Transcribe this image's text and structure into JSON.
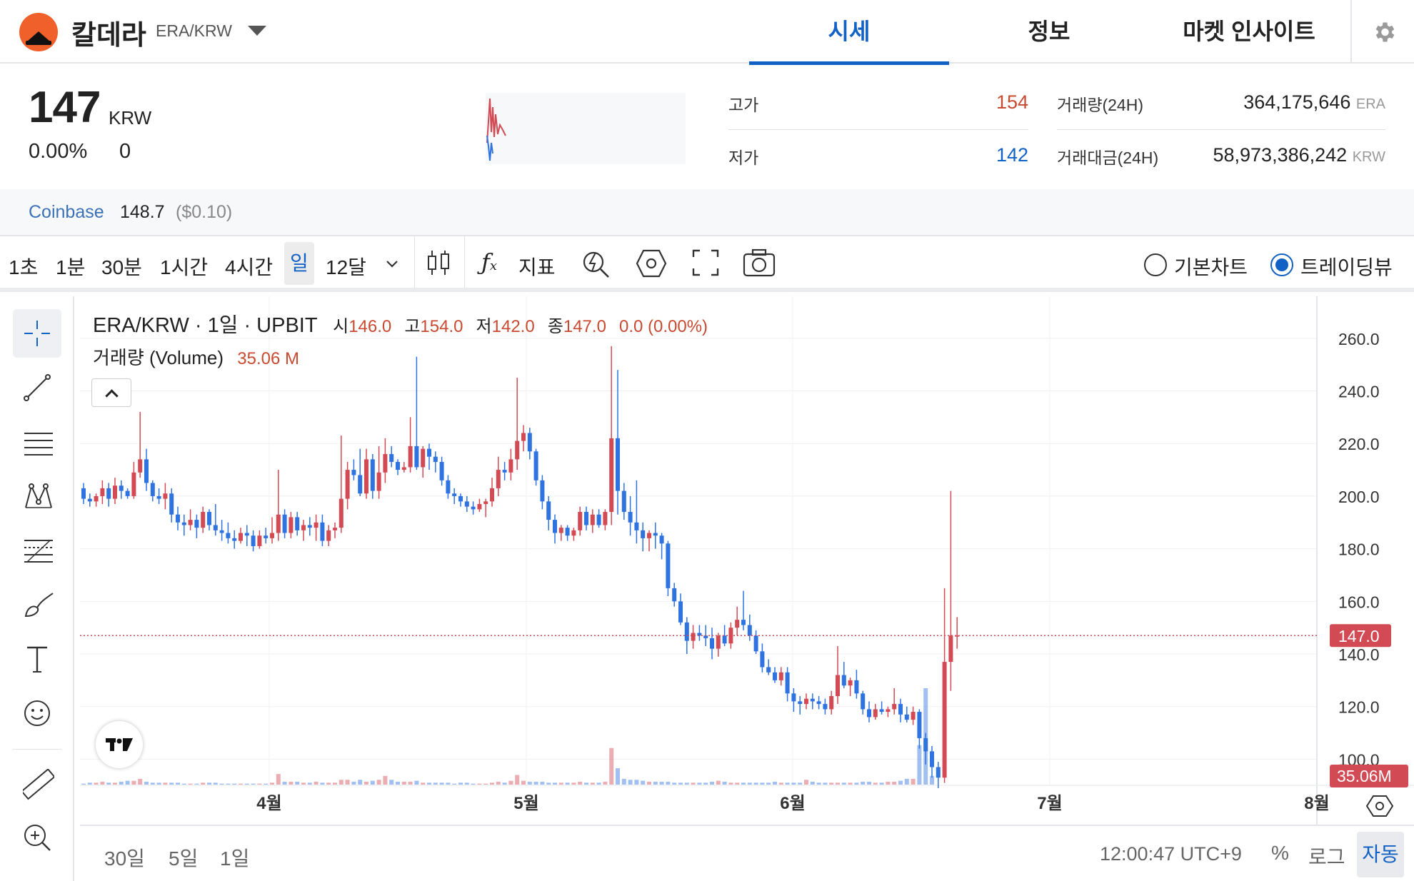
{
  "header": {
    "coin_name": "칼데라",
    "pair": "ERA/KRW",
    "tabs": [
      {
        "label": "시세",
        "active": true
      },
      {
        "label": "정보",
        "active": false
      },
      {
        "label": "마켓 인사이트",
        "active": false
      }
    ]
  },
  "summary": {
    "price": "147",
    "unit": "KRW",
    "change_pct": "0.00%",
    "change_abs": "0",
    "high_label": "고가",
    "high_value": "154",
    "low_label": "저가",
    "low_value": "142",
    "volume_label": "거래량(24H)",
    "volume_value": "364,175,646",
    "volume_unit": "ERA",
    "amount_label": "거래대금(24H)",
    "amount_value": "58,973,386,242",
    "amount_unit": "KRW"
  },
  "coinbase": {
    "name": "Coinbase",
    "price": "148.7",
    "usd": "($0.10)"
  },
  "toolbar": {
    "timeframes": [
      "1초",
      "1분",
      "30분",
      "1시간",
      "4시간",
      "일",
      "12달"
    ],
    "active_timeframe": "일",
    "indicator_label": "지표",
    "basic_chart": "기본차트",
    "tradingview": "트레이딩뷰"
  },
  "legend": {
    "symbol": "ERA/KRW · 1일 · UPBIT",
    "open_label": "시",
    "open": "146.0",
    "high_label": "고",
    "high": "154.0",
    "low_label": "저",
    "low": "142.0",
    "close_label": "종",
    "close": "147.0",
    "change": "0.0 (0.00%)",
    "volume_label": "거래량 (Volume)",
    "volume_value": "35.06 M"
  },
  "chart_data": {
    "type": "candlestick",
    "x_ticks": [
      "4월",
      "5월",
      "6월",
      "7월",
      "8월"
    ],
    "y_ticks": [
      "260.0",
      "240.0",
      "220.0",
      "200.0",
      "180.0",
      "160.0",
      "140.0",
      "120.0",
      "100.0"
    ],
    "ylim": [
      86,
      270
    ],
    "last_price_label": "147.0",
    "last_volume_label": "35.06M",
    "up_color": "#d24a54",
    "down_color": "#2e73e0",
    "candles_ohlc": [
      [
        203,
        205,
        197,
        199
      ],
      [
        199,
        201,
        196,
        198
      ],
      [
        198,
        201,
        196,
        200
      ],
      [
        200,
        206,
        197,
        203
      ],
      [
        203,
        205,
        196,
        199
      ],
      [
        199,
        207,
        197,
        204
      ],
      [
        204,
        206,
        199,
        202
      ],
      [
        202,
        203,
        199,
        200
      ],
      [
        200,
        213,
        199,
        209
      ],
      [
        209,
        232,
        207,
        214
      ],
      [
        214,
        218,
        202,
        205
      ],
      [
        205,
        206,
        198,
        200
      ],
      [
        200,
        203,
        197,
        199
      ],
      [
        199,
        205,
        195,
        201
      ],
      [
        201,
        203,
        190,
        193
      ],
      [
        193,
        196,
        187,
        190
      ],
      [
        190,
        193,
        185,
        189
      ],
      [
        189,
        195,
        187,
        191
      ],
      [
        191,
        193,
        184,
        188
      ],
      [
        188,
        196,
        186,
        194
      ],
      [
        194,
        195,
        187,
        189
      ],
      [
        189,
        197,
        185,
        187
      ],
      [
        187,
        191,
        183,
        186
      ],
      [
        186,
        190,
        182,
        184
      ],
      [
        184,
        187,
        180,
        183
      ],
      [
        183,
        188,
        182,
        186
      ],
      [
        186,
        189,
        181,
        185
      ],
      [
        185,
        187,
        179,
        181
      ],
      [
        181,
        187,
        180,
        185
      ],
      [
        185,
        188,
        182,
        184
      ],
      [
        184,
        192,
        182,
        186
      ],
      [
        186,
        210,
        183,
        193
      ],
      [
        193,
        195,
        184,
        186
      ],
      [
        186,
        194,
        184,
        192
      ],
      [
        192,
        194,
        185,
        187
      ],
      [
        187,
        191,
        183,
        189
      ],
      [
        189,
        192,
        185,
        188
      ],
      [
        188,
        193,
        183,
        190
      ],
      [
        190,
        193,
        181,
        183
      ],
      [
        183,
        189,
        181,
        187
      ],
      [
        187,
        190,
        184,
        188
      ],
      [
        188,
        223,
        186,
        199
      ],
      [
        199,
        213,
        195,
        210
      ],
      [
        210,
        214,
        206,
        208
      ],
      [
        208,
        218,
        200,
        201
      ],
      [
        201,
        218,
        199,
        214
      ],
      [
        214,
        216,
        199,
        202
      ],
      [
        202,
        219,
        199,
        209
      ],
      [
        209,
        222,
        205,
        216
      ],
      [
        216,
        219,
        211,
        213
      ],
      [
        213,
        214,
        208,
        210
      ],
      [
        210,
        213,
        209,
        211
      ],
      [
        211,
        230,
        209,
        219
      ],
      [
        219,
        253,
        210,
        211
      ],
      [
        211,
        219,
        207,
        218
      ],
      [
        218,
        220,
        210,
        215
      ],
      [
        215,
        217,
        209,
        213
      ],
      [
        213,
        215,
        204,
        206
      ],
      [
        206,
        208,
        199,
        201
      ],
      [
        201,
        203,
        197,
        200
      ],
      [
        200,
        201,
        196,
        198
      ],
      [
        198,
        200,
        194,
        196
      ],
      [
        196,
        198,
        193,
        195
      ],
      [
        195,
        199,
        194,
        197
      ],
      [
        197,
        199,
        192,
        198
      ],
      [
        198,
        207,
        196,
        203
      ],
      [
        203,
        215,
        200,
        210
      ],
      [
        210,
        213,
        206,
        209
      ],
      [
        209,
        218,
        206,
        214
      ],
      [
        214,
        245,
        210,
        221
      ],
      [
        221,
        227,
        217,
        224
      ],
      [
        224,
        226,
        214,
        217
      ],
      [
        217,
        218,
        204,
        206
      ],
      [
        206,
        208,
        195,
        198
      ],
      [
        198,
        200,
        187,
        191
      ],
      [
        191,
        193,
        182,
        186
      ],
      [
        186,
        189,
        183,
        188
      ],
      [
        188,
        189,
        183,
        185
      ],
      [
        185,
        188,
        183,
        187
      ],
      [
        187,
        196,
        185,
        194
      ],
      [
        194,
        196,
        187,
        189
      ],
      [
        189,
        195,
        186,
        193
      ],
      [
        193,
        195,
        188,
        189
      ],
      [
        189,
        195,
        187,
        194
      ],
      [
        194,
        257,
        189,
        222
      ],
      [
        222,
        248,
        193,
        202
      ],
      [
        202,
        205,
        191,
        194
      ],
      [
        194,
        200,
        185,
        190
      ],
      [
        190,
        206,
        182,
        187
      ],
      [
        187,
        190,
        179,
        184
      ],
      [
        184,
        187,
        179,
        186
      ],
      [
        186,
        190,
        180,
        185
      ],
      [
        185,
        186,
        176,
        182
      ],
      [
        182,
        183,
        162,
        165
      ],
      [
        165,
        167,
        158,
        160
      ],
      [
        160,
        163,
        151,
        152
      ],
      [
        152,
        154,
        140,
        145
      ],
      [
        145,
        151,
        142,
        148
      ],
      [
        148,
        151,
        145,
        147
      ],
      [
        147,
        151,
        143,
        146
      ],
      [
        146,
        150,
        138,
        142
      ],
      [
        142,
        148,
        139,
        147
      ],
      [
        147,
        151,
        143,
        144
      ],
      [
        144,
        152,
        142,
        150
      ],
      [
        150,
        158,
        147,
        153
      ],
      [
        153,
        164,
        149,
        151
      ],
      [
        151,
        155,
        145,
        147
      ],
      [
        147,
        149,
        140,
        141
      ],
      [
        141,
        144,
        133,
        135
      ],
      [
        135,
        138,
        132,
        133
      ],
      [
        133,
        135,
        129,
        130
      ],
      [
        130,
        135,
        128,
        133
      ],
      [
        133,
        135,
        122,
        125
      ],
      [
        125,
        127,
        118,
        122
      ],
      [
        122,
        124,
        117,
        121
      ],
      [
        121,
        125,
        119,
        123
      ],
      [
        123,
        125,
        119,
        122
      ],
      [
        122,
        124,
        119,
        121
      ],
      [
        121,
        123,
        117,
        119
      ],
      [
        119,
        126,
        117,
        124
      ],
      [
        124,
        143,
        121,
        132
      ],
      [
        132,
        137,
        127,
        128
      ],
      [
        128,
        131,
        124,
        130
      ],
      [
        130,
        134,
        123,
        125
      ],
      [
        125,
        126,
        117,
        119
      ],
      [
        119,
        122,
        114,
        116
      ],
      [
        116,
        121,
        115,
        119
      ],
      [
        119,
        122,
        117,
        118
      ],
      [
        118,
        120,
        116,
        119
      ],
      [
        119,
        127,
        117,
        121
      ],
      [
        121,
        123,
        114,
        117
      ],
      [
        117,
        120,
        114,
        115
      ],
      [
        115,
        120,
        113,
        118
      ],
      [
        118,
        119,
        104,
        108
      ],
      [
        108,
        110,
        98,
        103
      ],
      [
        103,
        105,
        93,
        97
      ],
      [
        97,
        99,
        89,
        93
      ],
      [
        93,
        165,
        91,
        137
      ],
      [
        137,
        202,
        126,
        147
      ],
      [
        147,
        154,
        142,
        147
      ]
    ],
    "volume_heights": [
      1,
      2,
      2,
      3,
      2,
      2,
      3,
      4,
      4,
      6,
      3,
      2,
      2,
      2,
      2,
      2,
      1,
      1,
      1,
      2,
      2,
      2,
      1,
      1,
      1,
      1,
      1,
      1,
      1,
      1,
      2,
      11,
      3,
      3,
      3,
      2,
      2,
      3,
      2,
      2,
      2,
      5,
      5,
      3,
      5,
      3,
      4,
      5,
      9,
      5,
      3,
      3,
      3,
      4,
      2,
      2,
      2,
      2,
      2,
      1,
      2,
      2,
      1,
      1,
      1,
      2,
      3,
      2,
      4,
      10,
      4,
      3,
      3,
      3,
      2,
      2,
      2,
      2,
      2,
      3,
      2,
      2,
      2,
      3,
      38,
      17,
      6,
      5,
      5,
      4,
      3,
      3,
      3,
      3,
      2,
      2,
      2,
      2,
      2,
      2,
      3,
      4,
      3,
      2,
      2,
      2,
      2,
      2,
      2,
      2,
      3,
      2,
      2,
      2,
      2,
      5,
      3,
      2,
      2,
      2,
      2,
      2,
      2,
      2,
      3,
      3,
      2,
      2,
      3,
      3,
      4,
      6,
      6,
      41,
      100,
      9
    ]
  },
  "bottom": {
    "ranges": [
      "30일",
      "5일",
      "1일"
    ],
    "clock": "12:00:47 UTC+9",
    "percent": "%",
    "log": "로그",
    "auto": "자동"
  }
}
